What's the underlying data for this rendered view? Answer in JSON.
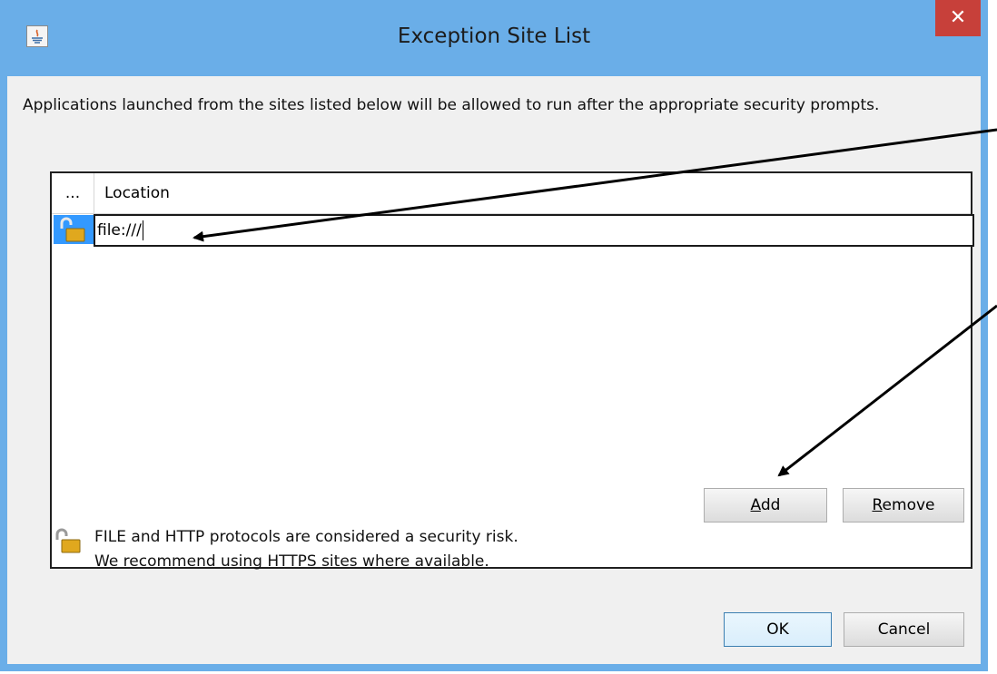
{
  "window": {
    "title": "Exception Site List",
    "close_glyph": "✕"
  },
  "description": "Applications launched from the sites listed below will be allowed to run after the appropriate security prompts.",
  "table": {
    "columns": [
      "...",
      "Location"
    ],
    "rows": [
      {
        "icon": "unlocked-padlock-icon",
        "location": "file:///"
      }
    ]
  },
  "buttons": {
    "add": {
      "mnemonic": "A",
      "rest": "dd"
    },
    "remove": {
      "mnemonic": "R",
      "rest": "emove"
    },
    "ok": "OK",
    "cancel": "Cancel"
  },
  "warning": {
    "icon": "unlocked-padlock-icon",
    "line1": "FILE and HTTP protocols are considered a security risk.",
    "line2": "We recommend using HTTPS sites where available."
  },
  "colors": {
    "titlebar": "#6aaee8",
    "close_button": "#c7403a",
    "selection": "#3399ff",
    "dialog_background": "#f0f0f0"
  },
  "annotations": {
    "arrow_color": "#000000",
    "count": 2
  }
}
